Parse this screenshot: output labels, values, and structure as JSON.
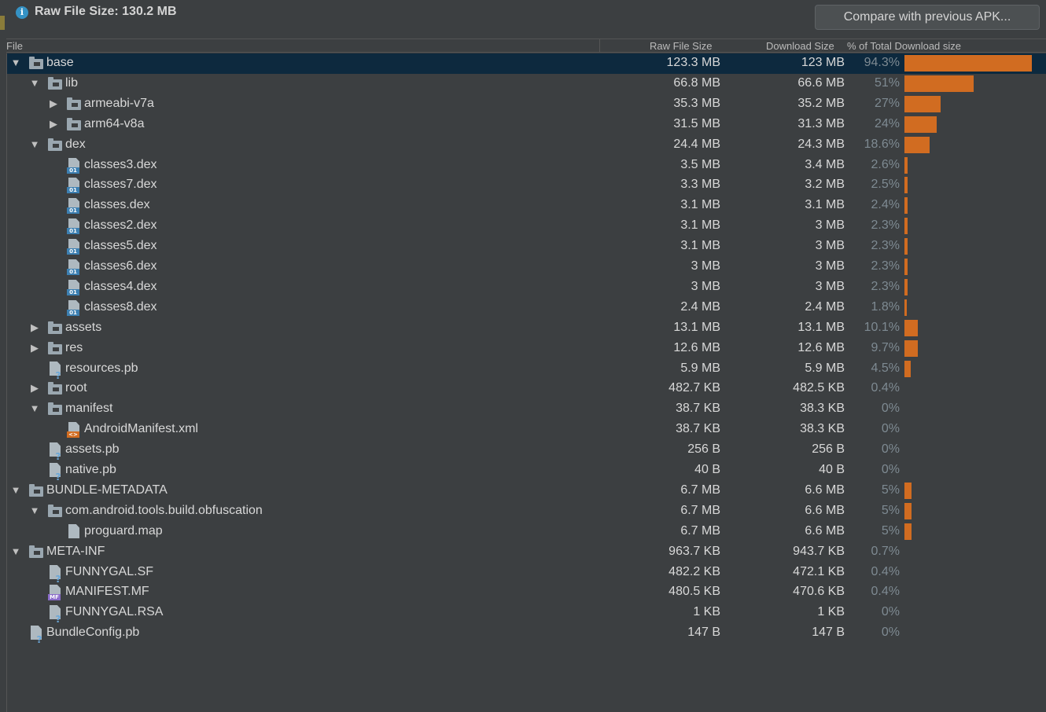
{
  "topbar": {
    "raw_file_size": "Raw File Size: 130.2 MB",
    "compare_button": "Compare with previous APK..."
  },
  "table": {
    "headers": {
      "file": "File",
      "raw_file_size": "Raw File Size",
      "download_size": "Download Size",
      "percent": "% of Total Download size"
    },
    "rows": [
      {
        "name": "base",
        "raw": "123.3 MB",
        "dl": "123 MB",
        "pct": "94.3%",
        "pct_value": 94.3,
        "depth": 0,
        "kind": "folder",
        "expanded": true,
        "toggle": true
      },
      {
        "name": "lib",
        "raw": "66.8 MB",
        "dl": "66.6 MB",
        "pct": "51%",
        "pct_value": 51,
        "depth": 1,
        "kind": "folder",
        "expanded": true,
        "toggle": true
      },
      {
        "name": "armeabi-v7a",
        "raw": "35.3 MB",
        "dl": "35.2 MB",
        "pct": "27%",
        "pct_value": 27,
        "depth": 2,
        "kind": "folder",
        "expanded": false,
        "toggle": true
      },
      {
        "name": "arm64-v8a",
        "raw": "31.5 MB",
        "dl": "31.3 MB",
        "pct": "24%",
        "pct_value": 24,
        "depth": 2,
        "kind": "folder",
        "expanded": false,
        "toggle": true
      },
      {
        "name": "dex",
        "raw": "24.4 MB",
        "dl": "24.3 MB",
        "pct": "18.6%",
        "pct_value": 18.6,
        "depth": 1,
        "kind": "folder",
        "expanded": true,
        "toggle": true
      },
      {
        "name": "classes3.dex",
        "raw": "3.5 MB",
        "dl": "3.4 MB",
        "pct": "2.6%",
        "pct_value": 2.6,
        "depth": 2,
        "kind": "dex",
        "toggle": false
      },
      {
        "name": "classes7.dex",
        "raw": "3.3 MB",
        "dl": "3.2 MB",
        "pct": "2.5%",
        "pct_value": 2.5,
        "depth": 2,
        "kind": "dex",
        "toggle": false
      },
      {
        "name": "classes.dex",
        "raw": "3.1 MB",
        "dl": "3.1 MB",
        "pct": "2.4%",
        "pct_value": 2.4,
        "depth": 2,
        "kind": "dex",
        "toggle": false
      },
      {
        "name": "classes2.dex",
        "raw": "3.1 MB",
        "dl": "3 MB",
        "pct": "2.3%",
        "pct_value": 2.3,
        "depth": 2,
        "kind": "dex",
        "toggle": false
      },
      {
        "name": "classes5.dex",
        "raw": "3.1 MB",
        "dl": "3 MB",
        "pct": "2.3%",
        "pct_value": 2.3,
        "depth": 2,
        "kind": "dex",
        "toggle": false
      },
      {
        "name": "classes6.dex",
        "raw": "3 MB",
        "dl": "3 MB",
        "pct": "2.3%",
        "pct_value": 2.3,
        "depth": 2,
        "kind": "dex",
        "toggle": false
      },
      {
        "name": "classes4.dex",
        "raw": "3 MB",
        "dl": "3 MB",
        "pct": "2.3%",
        "pct_value": 2.3,
        "depth": 2,
        "kind": "dex",
        "toggle": false
      },
      {
        "name": "classes8.dex",
        "raw": "2.4 MB",
        "dl": "2.4 MB",
        "pct": "1.8%",
        "pct_value": 1.8,
        "depth": 2,
        "kind": "dex",
        "toggle": false
      },
      {
        "name": "assets",
        "raw": "13.1 MB",
        "dl": "13.1 MB",
        "pct": "10.1%",
        "pct_value": 10.1,
        "depth": 1,
        "kind": "folder",
        "expanded": false,
        "toggle": true
      },
      {
        "name": "res",
        "raw": "12.6 MB",
        "dl": "12.6 MB",
        "pct": "9.7%",
        "pct_value": 9.7,
        "depth": 1,
        "kind": "folder",
        "expanded": false,
        "toggle": true
      },
      {
        "name": "resources.pb",
        "raw": "5.9 MB",
        "dl": "5.9 MB",
        "pct": "4.5%",
        "pct_value": 4.5,
        "depth": 1,
        "kind": "unknown",
        "toggle": false
      },
      {
        "name": "root",
        "raw": "482.7 KB",
        "dl": "482.5 KB",
        "pct": "0.4%",
        "pct_value": 0.4,
        "depth": 1,
        "kind": "folder",
        "expanded": false,
        "toggle": true
      },
      {
        "name": "manifest",
        "raw": "38.7 KB",
        "dl": "38.3 KB",
        "pct": "0%",
        "pct_value": 0,
        "depth": 1,
        "kind": "folder",
        "expanded": true,
        "toggle": true
      },
      {
        "name": "AndroidManifest.xml",
        "raw": "38.7 KB",
        "dl": "38.3 KB",
        "pct": "0%",
        "pct_value": 0,
        "depth": 2,
        "kind": "xml",
        "toggle": false
      },
      {
        "name": "assets.pb",
        "raw": "256 B",
        "dl": "256 B",
        "pct": "0%",
        "pct_value": 0,
        "depth": 1,
        "kind": "unknown",
        "toggle": false
      },
      {
        "name": "native.pb",
        "raw": "40 B",
        "dl": "40 B",
        "pct": "0%",
        "pct_value": 0,
        "depth": 1,
        "kind": "unknown",
        "toggle": false
      },
      {
        "name": "BUNDLE-METADATA",
        "raw": "6.7 MB",
        "dl": "6.6 MB",
        "pct": "5%",
        "pct_value": 5,
        "depth": 0,
        "kind": "folder",
        "expanded": true,
        "toggle": true
      },
      {
        "name": "com.android.tools.build.obfuscation",
        "raw": "6.7 MB",
        "dl": "6.6 MB",
        "pct": "5%",
        "pct_value": 5,
        "depth": 1,
        "kind": "folder",
        "expanded": true,
        "toggle": true
      },
      {
        "name": "proguard.map",
        "raw": "6.7 MB",
        "dl": "6.6 MB",
        "pct": "5%",
        "pct_value": 5,
        "depth": 2,
        "kind": "text",
        "toggle": false
      },
      {
        "name": "META-INF",
        "raw": "963.7 KB",
        "dl": "943.7 KB",
        "pct": "0.7%",
        "pct_value": 0.7,
        "depth": 0,
        "kind": "folder",
        "expanded": true,
        "toggle": true
      },
      {
        "name": "FUNNYGAL.SF",
        "raw": "482.2 KB",
        "dl": "472.1 KB",
        "pct": "0.4%",
        "pct_value": 0.4,
        "depth": 1,
        "kind": "unknown",
        "toggle": false
      },
      {
        "name": "MANIFEST.MF",
        "raw": "480.5 KB",
        "dl": "470.6 KB",
        "pct": "0.4%",
        "pct_value": 0.4,
        "depth": 1,
        "kind": "mf",
        "toggle": false
      },
      {
        "name": "FUNNYGAL.RSA",
        "raw": "1 KB",
        "dl": "1 KB",
        "pct": "0%",
        "pct_value": 0,
        "depth": 1,
        "kind": "unknown",
        "toggle": false
      },
      {
        "name": "BundleConfig.pb",
        "raw": "147 B",
        "dl": "147 B",
        "pct": "0%",
        "pct_value": 0,
        "depth": 0,
        "kind": "unknown",
        "toggle": false
      }
    ]
  },
  "colors": {
    "background": "#3c3f41",
    "selection": "#0d293e",
    "bar": "#d16c21",
    "info": "#3592c4"
  }
}
